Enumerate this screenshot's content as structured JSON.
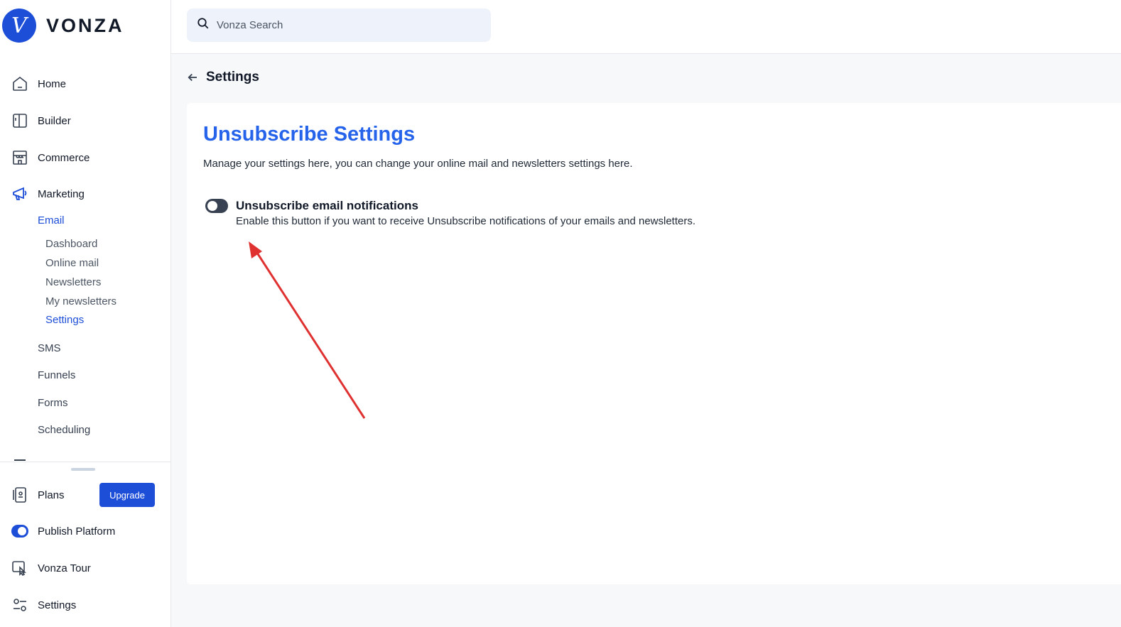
{
  "brand": {
    "logo_letter": "V",
    "name": "VONZA"
  },
  "search": {
    "placeholder": "Vonza Search"
  },
  "sidebar": {
    "items": [
      {
        "label": "Home"
      },
      {
        "label": "Builder"
      },
      {
        "label": "Commerce"
      },
      {
        "label": "Marketing"
      }
    ],
    "marketing_sub": [
      {
        "label": "Email"
      },
      {
        "label": "SMS"
      },
      {
        "label": "Funnels"
      },
      {
        "label": "Forms"
      },
      {
        "label": "Scheduling"
      }
    ],
    "email_sub": [
      {
        "label": "Dashboard"
      },
      {
        "label": "Online mail"
      },
      {
        "label": "Newsletters"
      },
      {
        "label": "My newsletters"
      },
      {
        "label": "Settings"
      }
    ],
    "bottom": {
      "plans_label": "Plans",
      "upgrade_label": "Upgrade",
      "publish_label": "Publish Platform",
      "tour_label": "Vonza Tour",
      "settings_label": "Settings"
    }
  },
  "page": {
    "breadcrumb_title": "Settings",
    "card_title": "Unsubscribe Settings",
    "card_description": "Manage your settings here, you can change your online mail and newsletters settings here.",
    "option": {
      "label": "Unsubscribe email notifications",
      "description": "Enable this button if you want to receive Unsubscribe notifications of your emails and newsletters.",
      "enabled": false
    }
  },
  "colors": {
    "accent": "#1d4ed8",
    "title_blue": "#2563eb",
    "annotation_red": "#e03131"
  }
}
